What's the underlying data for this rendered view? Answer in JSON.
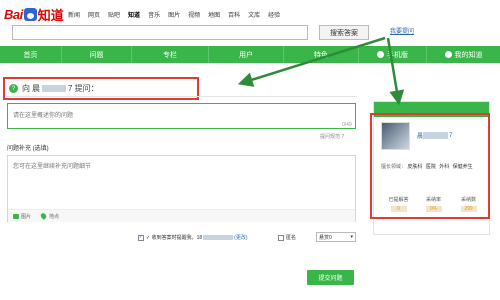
{
  "logo": {
    "bai": "Bai",
    "du": "知道"
  },
  "top_nav": [
    "新闻",
    "网页",
    "贴吧",
    "知道",
    "音乐",
    "图片",
    "视频",
    "地图",
    "百科",
    "文库",
    "经验"
  ],
  "top_nav_active": "知道",
  "search": {
    "button": "搜索答案",
    "help": "我要提问"
  },
  "green_nav": [
    "首页",
    "问题",
    "专栏",
    "用户",
    "特色",
    "手机版",
    "我的知道"
  ],
  "ask": {
    "prefix": "向",
    "blurred_name_start": "晨",
    "suffix": "7 提问："
  },
  "title_input": {
    "placeholder": "请在这里概述你的问题",
    "count": "0/49",
    "tip": "提问规范 ?"
  },
  "supplement": {
    "label": "问题补充 (选填)",
    "placeholder": "您可在这里继续补充问题细节",
    "tool_image": "图片",
    "tool_location": "地点"
  },
  "options": {
    "notify_label": "✓ 收到答案时提醒我，18",
    "notify_change": "(更改)",
    "anonymous": "匿名",
    "reward": "悬赏0"
  },
  "submit": "提交问题",
  "profile": {
    "name_start": "晨",
    "name_end": "7",
    "tags_label": "擅长领域：",
    "tags": [
      "皮肤科",
      "医院",
      "外科",
      "保健养生"
    ],
    "stats": [
      {
        "label": "已提解答",
        "value": "0"
      },
      {
        "label": "采纳率",
        "value": "0%"
      },
      {
        "label": "采纳数",
        "value": "299"
      }
    ]
  },
  "colors": {
    "brand_green": "#39b54a",
    "highlight_red": "#e53935",
    "logo_red": "#e10601",
    "logo_blue": "#2d66d4"
  }
}
